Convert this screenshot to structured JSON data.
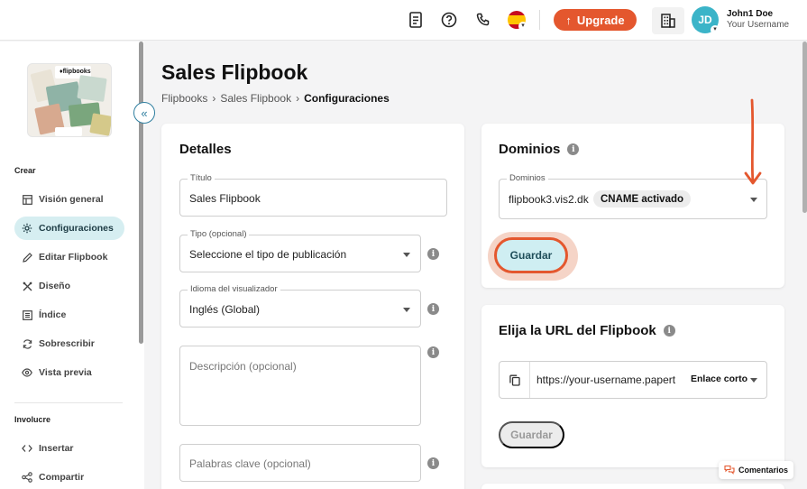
{
  "topbar": {
    "upgrade_label": "Upgrade",
    "avatar_initials": "JD",
    "user_name": "John1 Doe",
    "user_handle": "Your Username"
  },
  "sidebar": {
    "section_create": "Crear",
    "section_involve": "Involucre",
    "items": [
      {
        "label": "Visión general",
        "icon": "layout-icon"
      },
      {
        "label": "Configuraciones",
        "icon": "gear-icon"
      },
      {
        "label": "Editar Flipbook",
        "icon": "pencil-icon"
      },
      {
        "label": "Diseño",
        "icon": "design-tools-icon"
      },
      {
        "label": "Índice",
        "icon": "index-list-icon"
      },
      {
        "label": "Sobrescribir",
        "icon": "refresh-icon"
      },
      {
        "label": "Vista previa",
        "icon": "eye-icon"
      }
    ],
    "involve_items": [
      {
        "label": "Insertar",
        "icon": "code-icon"
      },
      {
        "label": "Compartir",
        "icon": "share-icon"
      }
    ]
  },
  "page": {
    "title": "Sales Flipbook",
    "breadcrumb": [
      "Flipbooks",
      "Sales Flipbook",
      "Configuraciones"
    ]
  },
  "details": {
    "title": "Detalles",
    "titulo_label": "Título",
    "titulo_value": "Sales Flipbook",
    "tipo_label": "Tipo (opcional)",
    "tipo_value": "Seleccione el tipo de publicación",
    "idioma_label": "Idioma del visualizador",
    "idioma_value": "Inglés (Global)",
    "descripcion_placeholder": "Descripción (opcional)",
    "palabras_placeholder": "Palabras clave (opcional)"
  },
  "domains": {
    "title": "Dominios",
    "field_label": "Dominios",
    "value": "flipbook3.vis2.dk",
    "badge": "CNAME activado",
    "save_label": "Guardar"
  },
  "url": {
    "title": "Elija la URL del Flipbook",
    "value": "https://your-username.papert",
    "mode": "Enlace corto",
    "save_label": "Guardar"
  },
  "comments_label": "Comentarios",
  "colors": {
    "accent": "#e4572e",
    "teal": "#3bb4c8",
    "active_bg": "#d6eef1"
  }
}
